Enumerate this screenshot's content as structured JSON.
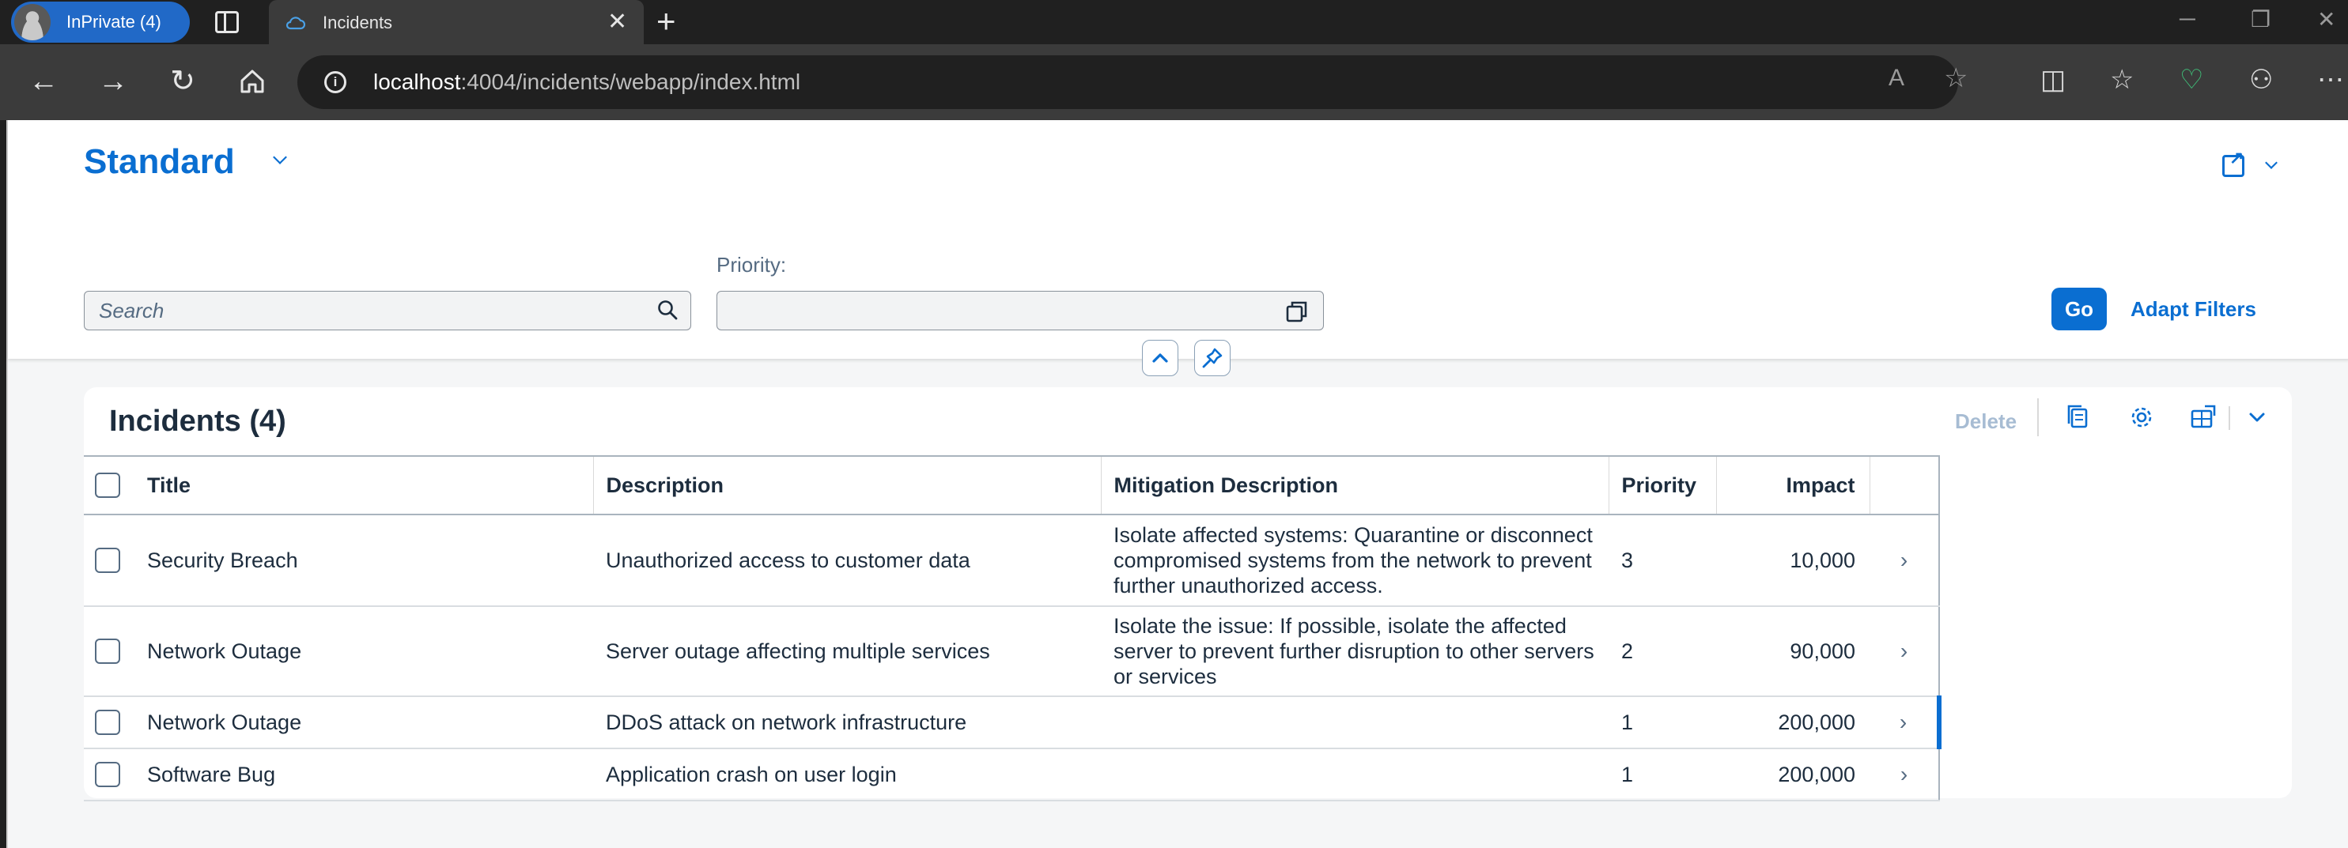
{
  "browser": {
    "profile_label": "InPrivate (4)",
    "tab_title": "Incidents",
    "url_host": "localhost",
    "url_path": ":4004/incidents/webapp/index.html"
  },
  "header": {
    "variant_title": "Standard",
    "search_placeholder": "Search",
    "priority_label": "Priority:",
    "go_label": "Go",
    "adapt_filters_label": "Adapt Filters"
  },
  "table": {
    "title": "Incidents (4)",
    "delete_label": "Delete",
    "columns": [
      "Title",
      "Description",
      "Mitigation Description",
      "Priority",
      "Impact"
    ],
    "rows": [
      {
        "title": "Security Breach",
        "description": "Unauthorized access to customer data",
        "mitigation": "Isolate affected systems: Quarantine or disconnect compromised systems from the network to prevent further unauthorized access.",
        "priority": "3",
        "impact": "10,000"
      },
      {
        "title": "Network Outage",
        "description": "Server outage affecting multiple services",
        "mitigation": "Isolate the issue: If possible, isolate the affected server to prevent further disruption to other servers or services",
        "priority": "2",
        "impact": "90,000"
      },
      {
        "title": "Network Outage",
        "description": "DDoS attack on network infrastructure",
        "mitigation": "",
        "priority": "1",
        "impact": "200,000"
      },
      {
        "title": "Software Bug",
        "description": "Application crash on user login",
        "mitigation": "",
        "priority": "1",
        "impact": "200,000"
      }
    ]
  },
  "colors": {
    "accent": "#0a6ed1",
    "text": "#1d2d3e",
    "disabled": "#a7bcd3"
  }
}
